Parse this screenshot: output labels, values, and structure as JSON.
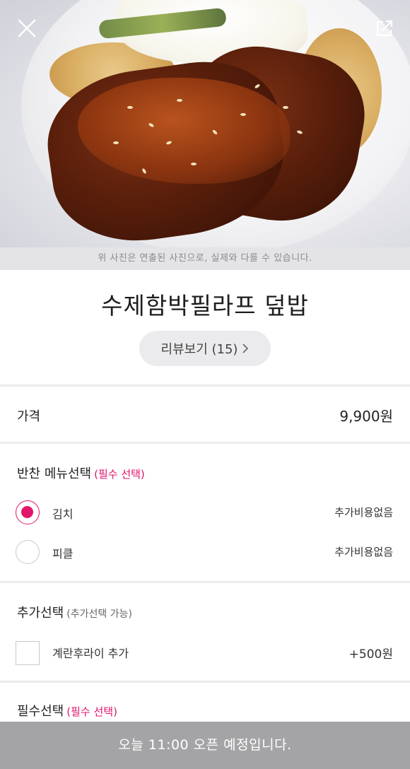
{
  "hero": {
    "notice": "위 사진은 연출된 사진으로, 실제와 다를 수 있습니다.",
    "icons": {
      "close": "close-icon",
      "share": "share-icon"
    }
  },
  "menu": {
    "title": "수제함박필라프 덮밥",
    "review_button": "리뷰보기 (15)"
  },
  "price": {
    "label": "가격",
    "value": "9,900원"
  },
  "side_menu": {
    "heading": "반찬 메뉴선택",
    "tag": "(필수 선택)",
    "options": [
      {
        "label": "김치",
        "price": "추가비용없음",
        "selected": true
      },
      {
        "label": "피클",
        "price": "추가비용없음",
        "selected": false
      }
    ]
  },
  "extra": {
    "heading": "추가선택",
    "tag": "(추가선택 가능)",
    "options": [
      {
        "label": "계란후라이 추가",
        "price": "+500원",
        "checked": false
      }
    ]
  },
  "required": {
    "heading": "필수선택",
    "tag": "(필수 선택)"
  },
  "footer": {
    "status": "오늘 11:00 오픈 예정입니다."
  },
  "colors": {
    "accent": "#e0156b",
    "footer_bg": "#a4a4a6",
    "notice_bg": "#e4e4e6"
  }
}
